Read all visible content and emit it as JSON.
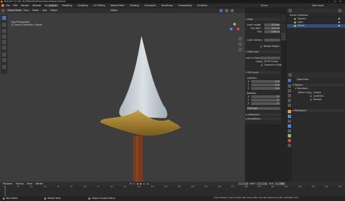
{
  "titlebar": {
    "title": "Blender* [C:\\My Stuff\\Models\\Props\\Sword\\Sword.blend]"
  },
  "menubar": {
    "menus": [
      "File",
      "Edit",
      "Render",
      "Window",
      "Help"
    ],
    "workspaces": [
      "Layout",
      "Modeling",
      "Sculpting",
      "UV Editing",
      "Texture Paint",
      "Shading",
      "Animation",
      "Rendering",
      "Compositing",
      "Scripting"
    ],
    "active_workspace": "Layout",
    "scene": "Scene",
    "view_layer": "View Layer"
  },
  "viewport_header": {
    "mode": "Object Mode",
    "menus": [
      "View",
      "Select",
      "Add",
      "Object"
    ],
    "transform": "Global"
  },
  "viewport": {
    "overlay_title": "User Perspective",
    "overlay_subtitle": "(1) Scene Collection | Sword"
  },
  "npanel": {
    "view_header": "View",
    "focal_length_label": "Focal Length",
    "focal_length": "50 mm",
    "clip_start_label": "Clip Start",
    "clip_start": "0.01 m",
    "clip_end_label": "End",
    "clip_end": "1000 m",
    "local_camera_label": "Local Camera",
    "render_region_label": "Render Region",
    "view_lock_header": "View Lock",
    "lock_to_object_label": "Lock to Object",
    "lock_label": "Lock",
    "lock_to_3d_cursor": "To 3D Cursor",
    "camera_to_view": "Camera to View",
    "cursor_header": "3D Cursor",
    "location_label": "Location:",
    "axes": [
      "X",
      "Y",
      "Z"
    ],
    "location_values": [
      "0 m",
      "0 m",
      "0 m"
    ],
    "rotation_label": "Rotation:",
    "rotation_values": [
      "0°",
      "0°",
      "0°"
    ],
    "rotation_mode": "XYZ Euler",
    "collections_header": "Collections",
    "annotations_header": "Annotations",
    "tabs": [
      "Item",
      "Tool",
      "View"
    ]
  },
  "outliner": {
    "root": "Scene Collection",
    "items": [
      "Camera",
      "Light",
      "Sword"
    ]
  },
  "properties": {
    "object_name": "Object Blur",
    "options_header": "Options",
    "transform_header": "Transform",
    "affect_only_label": "Affect Only",
    "affect_options": [
      "Origins",
      "Locations",
      "Parents"
    ],
    "workspace_header": "Workspace"
  },
  "timeline": {
    "menus": [
      "Playback",
      "Keying",
      "View",
      "Marker"
    ],
    "current_frame": "1",
    "start_label": "Start",
    "start": "1",
    "end_label": "End",
    "end": "250",
    "ticks": [
      "0",
      "10",
      "20",
      "30",
      "40",
      "50",
      "60",
      "70",
      "80",
      "90",
      "100",
      "110",
      "120",
      "130",
      "140",
      "150",
      "160",
      "170",
      "180",
      "190",
      "200",
      "210",
      "220",
      "230",
      "240",
      "250"
    ]
  },
  "statusbar": {
    "left": "Box Select",
    "mid1": "Rotate View",
    "mid2": "Object Context Menu",
    "right": "Scene Collection | Sword | Verts:1,418 | Faces:1,384 | Tris:2,764 | Objects:1/3 | Mem: 38.5 MiB | 2.83.0"
  },
  "colors": {
    "accent": "#4772b3",
    "active_tab": "#4a4a4a",
    "grid": "#3d3d3d"
  }
}
